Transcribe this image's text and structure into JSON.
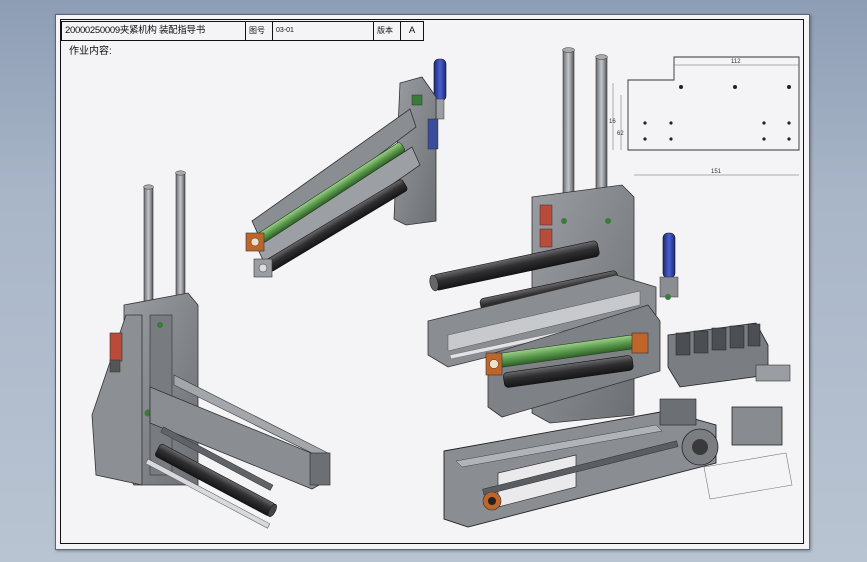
{
  "title_block": {
    "title": "20000250009夹紧机构 装配指导书",
    "drawing_no_label": "图号",
    "drawing_no_value": "03-01",
    "version_label": "版本",
    "version_value": "A"
  },
  "content_label": "作业内容:",
  "drawing": {
    "dimensions": [
      "112",
      "151",
      "16",
      "62"
    ]
  },
  "colors": {
    "background": "#a9b6c8",
    "sheet": "#f4f4f6",
    "frame_gray": "#7d8085",
    "roller_dark": "#3a3a3c",
    "roller_green": "#5a9a4c",
    "cylinder_blue": "#2b3c9a",
    "bracket_orange": "#c0652a"
  }
}
